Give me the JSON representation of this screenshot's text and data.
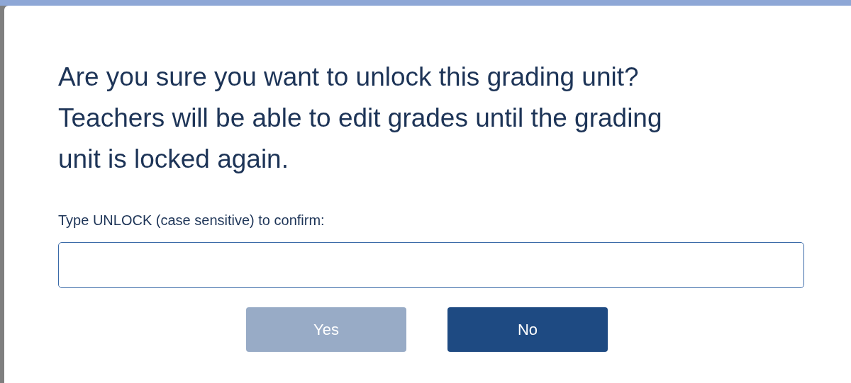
{
  "dialog": {
    "message": "Are you sure you want to unlock this grading unit? Teachers will be able to edit grades until the grading unit is locked again.",
    "confirm_label": "Type UNLOCK (case sensitive) to confirm:",
    "buttons": [
      {
        "label": "Yes",
        "disabled": true
      },
      {
        "label": "No",
        "disabled": false
      }
    ]
  }
}
